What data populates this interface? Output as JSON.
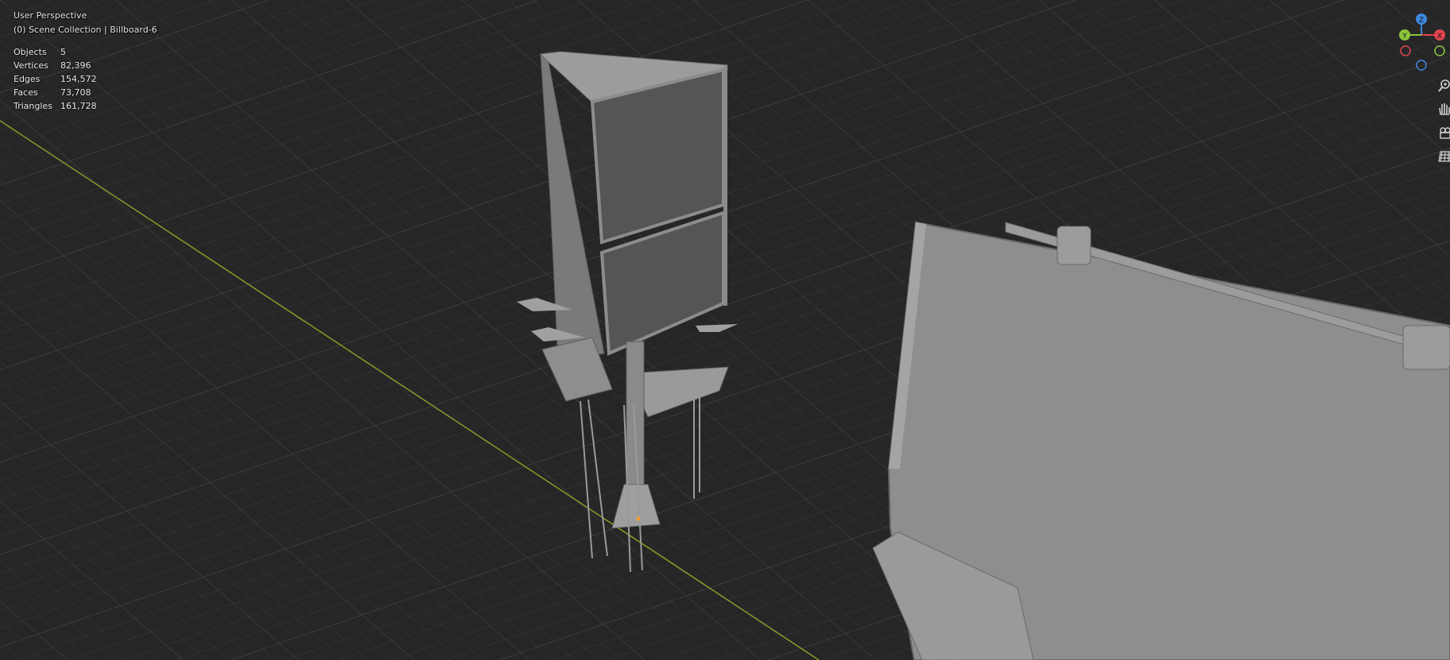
{
  "viewport": {
    "view_name": "User Perspective",
    "collection_path": "(0) Scene Collection | Billboard-6"
  },
  "stats": [
    {
      "label": "Objects",
      "value": "5"
    },
    {
      "label": "Vertices",
      "value": "82,396"
    },
    {
      "label": "Edges",
      "value": "154,572"
    },
    {
      "label": "Faces",
      "value": "73,708"
    },
    {
      "label": "Triangles",
      "value": "161,728"
    }
  ],
  "gizmo": {
    "z_label": "Z",
    "y_label": "Y",
    "x_label": "X",
    "colors": {
      "x": "#e2444f",
      "y": "#8cc63e",
      "z": "#3d89e0"
    }
  },
  "nav_tools": [
    {
      "name": "zoom-icon"
    },
    {
      "name": "hand-pan-icon"
    },
    {
      "name": "camera-icon"
    },
    {
      "name": "grid-perspective-icon"
    }
  ],
  "colors": {
    "background": "#2a2a2a",
    "grid_line": "#3d3d3d",
    "axis_line": "#8a9a2a",
    "model_gray": "#8e8e8e"
  }
}
